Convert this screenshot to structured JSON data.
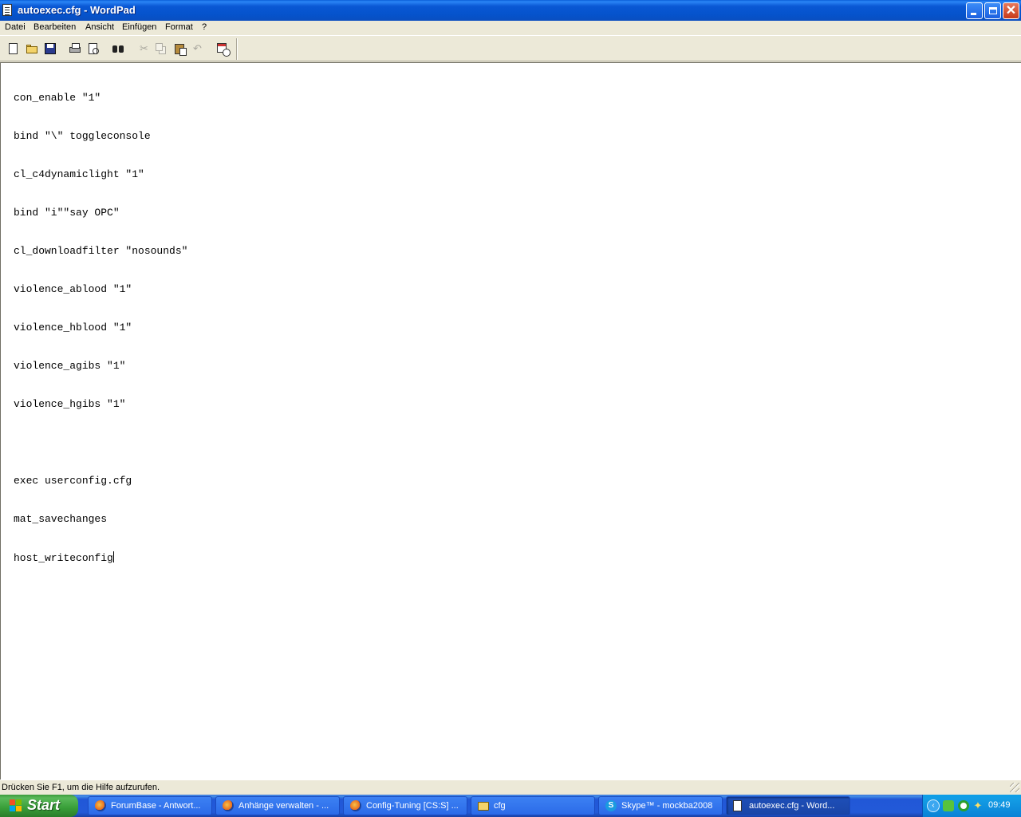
{
  "window": {
    "title": "autoexec.cfg - WordPad"
  },
  "titlebar_buttons": {
    "close": "✕"
  },
  "menu": [
    {
      "label": "Datei"
    },
    {
      "label": "Bearbeiten"
    },
    {
      "label": "Ansicht"
    },
    {
      "label": "Einfügen"
    },
    {
      "label": "Format"
    },
    {
      "label": "?"
    }
  ],
  "toolbar": {
    "icons": [
      "new-icon",
      "open-icon",
      "save-icon",
      "print-icon",
      "print-preview-icon",
      "find-icon",
      "cut-icon",
      "copy-icon",
      "paste-icon",
      "undo-icon",
      "date-time-icon"
    ],
    "cut_glyph": "✂",
    "undo_glyph": "↶"
  },
  "document": {
    "lines": [
      "con_enable \"1\"",
      "bind \"\\\" toggleconsole",
      "cl_c4dynamiclight \"1\"",
      "bind \"i\"\"say OPC\"",
      "cl_downloadfilter \"nosounds\"",
      "violence_ablood \"1\"",
      "violence_hblood \"1\"",
      "violence_agibs \"1\"",
      "violence_hgibs \"1\"",
      "",
      "exec userconfig.cfg",
      "mat_savechanges",
      "host_writeconfig"
    ]
  },
  "statusbar": {
    "text": "Drücken Sie F1, um die Hilfe aufzurufen."
  },
  "taskbar": {
    "start_label": "Start",
    "tasks": [
      {
        "label": "ForumBase - Antwort...",
        "icon": "firefox-icon"
      },
      {
        "label": "Anhänge verwalten - ...",
        "icon": "firefox-icon"
      },
      {
        "label": "Config-Tuning [CS:S] ...",
        "icon": "firefox-icon"
      },
      {
        "label": "cfg",
        "icon": "folder-icon"
      },
      {
        "label": "Skype™ - mockba2008",
        "icon": "skype-icon"
      },
      {
        "label": "autoexec.cfg - Word...",
        "icon": "wordpad-icon",
        "active": true
      }
    ],
    "tray": {
      "chevron": "‹",
      "clock": "09:49"
    }
  },
  "colors": {
    "titlebar": "#0a58d4",
    "taskbar": "#225ad8",
    "start_button": "#389e38",
    "chrome": "#ece9d8"
  }
}
